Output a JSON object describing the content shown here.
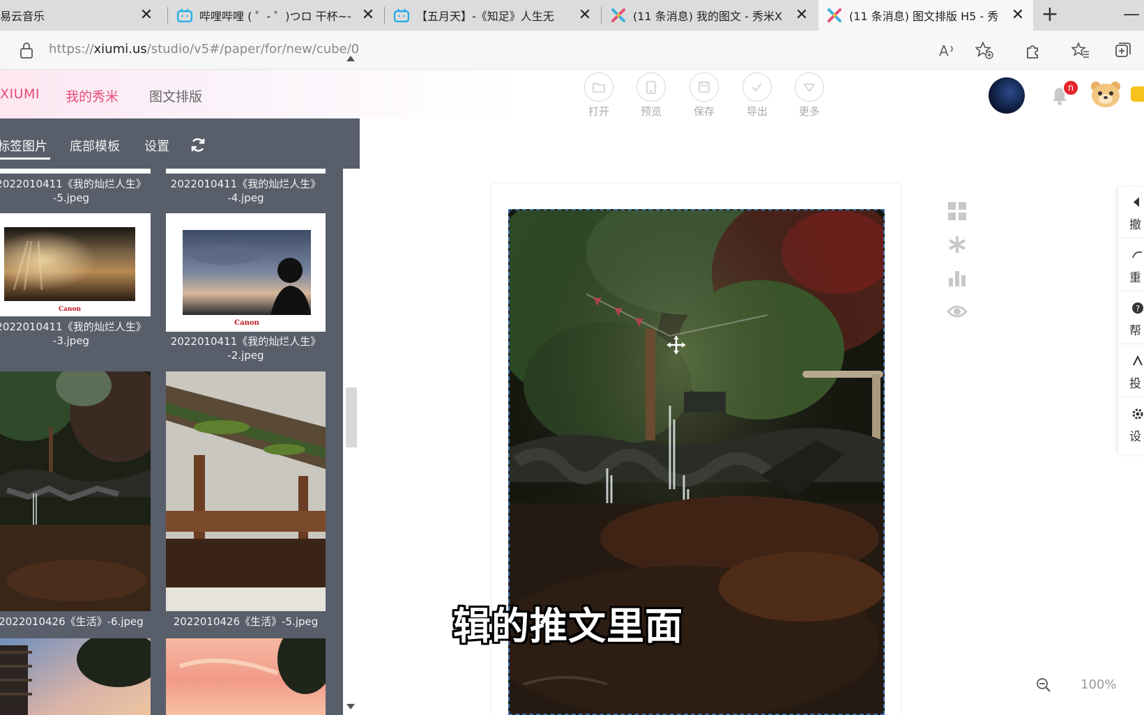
{
  "browser": {
    "tabs": [
      {
        "title": "易云音乐",
        "icon": "none"
      },
      {
        "title": "哔哩哔哩 ( ゜- ゜)つロ 干杯~-",
        "icon": "bilibili-icon"
      },
      {
        "title": "【五月天】-《知足》人生无",
        "icon": "bilibili-icon"
      },
      {
        "title": "(11 条消息) 我的图文 - 秀米X",
        "icon": "xiumi-icon"
      },
      {
        "title": "(11 条消息) 图文排版 H5 - 秀",
        "icon": "xiumi-icon"
      }
    ],
    "tab_close": "✕",
    "new_tab": "+",
    "minimize": "—",
    "url_prefix": "https://",
    "url_host": "xiumi.us",
    "url_path": "/studio/v5#/paper/for/new/cube/0"
  },
  "app": {
    "logo": "XIUMI",
    "nav": [
      "我的秀米",
      "图文排版"
    ],
    "toolbar": [
      {
        "label": "打开",
        "icon": "open-icon"
      },
      {
        "label": "预览",
        "icon": "preview-icon"
      },
      {
        "label": "保存",
        "icon": "save-icon"
      },
      {
        "label": "导出",
        "icon": "export-icon"
      },
      {
        "label": "更多",
        "icon": "more-icon"
      }
    ],
    "notification_count": "n"
  },
  "panel": {
    "tabs": [
      "标签图片",
      "底部模板",
      "设置"
    ],
    "items": [
      {
        "caption_l1": "2022010411《我的灿烂人生》",
        "caption_l2": "-5.jpeg"
      },
      {
        "caption_l1": "2022010411《我的灿烂人生》",
        "caption_l2": "-4.jpeg"
      },
      {
        "caption_l1": "2022010411《我的灿烂人生》",
        "caption_l2": "-3.jpeg"
      },
      {
        "caption_l1": "2022010411《我的灿烂人生》",
        "caption_l2": "-2.jpeg"
      },
      {
        "caption_l1": "2022010426《生活》-6.jpeg",
        "caption_l2": ""
      },
      {
        "caption_l1": "2022010426《生活》-5.jpeg",
        "caption_l2": ""
      }
    ],
    "photo_brand": "Canon"
  },
  "editor": {
    "side_tools": [
      "grid-icon",
      "asterisk-icon",
      "bar-chart-icon",
      "eye-icon"
    ],
    "right_rail": [
      "撤",
      "重",
      "帮",
      "投",
      "设"
    ],
    "zoom": "100%",
    "subtitle": "辑的推文里面"
  },
  "colors": {
    "accent": "#e84d73",
    "panel": "#585e6a",
    "selection": "#3b6fb0"
  }
}
